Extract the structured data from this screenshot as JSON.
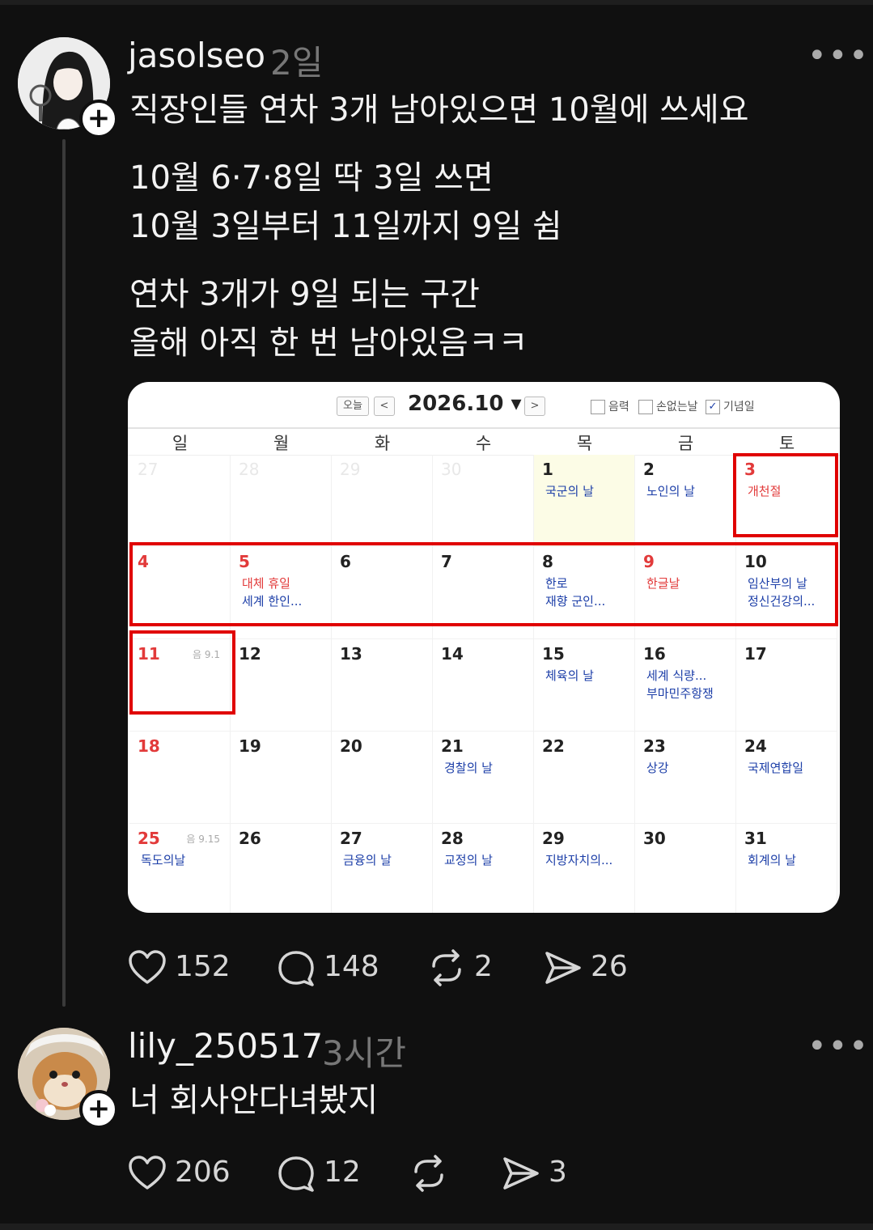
{
  "post": {
    "author": "jasolseo",
    "time": "2일",
    "more": "•••",
    "title_line": "직장인들 연차 3개 남아있으면 10월에 쓰세요",
    "body_lines": [
      "10월 6·7·8일 딱 3일 쓰면",
      "10월 3일부터 11일까지 9일 쉼",
      "연차 3개가 9일 되는 구간",
      "올해 아직 한 번 남아있음ㅋㅋ"
    ],
    "actions": {
      "likes": "152",
      "comments": "148",
      "reposts": "2",
      "shares": "26"
    }
  },
  "calendar": {
    "today_btn": "오늘",
    "prev": "<",
    "next": ">",
    "title": "2026.10 ▾",
    "options": [
      "음력",
      "손없는날",
      "기념일"
    ],
    "weekdays": [
      "일",
      "월",
      "화",
      "수",
      "목",
      "금",
      "토"
    ],
    "weeks": [
      [
        {
          "d": "27",
          "faded": true
        },
        {
          "d": "28",
          "faded": true
        },
        {
          "d": "29",
          "faded": true
        },
        {
          "d": "30",
          "faded": true
        },
        {
          "d": "1",
          "events": [
            "국군의 날"
          ],
          "today": true
        },
        {
          "d": "2",
          "events": [
            "노인의 날"
          ]
        },
        {
          "d": "3",
          "red": true,
          "events": [
            "개천절"
          ],
          "ev_red": true
        }
      ],
      [
        {
          "d": "4",
          "red": true
        },
        {
          "d": "5",
          "red": true,
          "events": [
            "대체 휴일",
            "세계 한인..."
          ],
          "ev_red_first": true
        },
        {
          "d": "6"
        },
        {
          "d": "7"
        },
        {
          "d": "8",
          "events": [
            "한로",
            "재향 군인..."
          ]
        },
        {
          "d": "9",
          "red": true,
          "events": [
            "한글날"
          ],
          "ev_red": true
        },
        {
          "d": "10",
          "events": [
            "임산부의 날",
            "정신건강의..."
          ]
        }
      ],
      [
        {
          "d": "11",
          "red": true,
          "lunar": "음 9.1"
        },
        {
          "d": "12"
        },
        {
          "d": "13"
        },
        {
          "d": "14"
        },
        {
          "d": "15",
          "events": [
            "체육의 날"
          ]
        },
        {
          "d": "16",
          "events": [
            "세계 식량...",
            "부마민주항쟁"
          ]
        },
        {
          "d": "17"
        }
      ],
      [
        {
          "d": "18",
          "red": true
        },
        {
          "d": "19"
        },
        {
          "d": "20"
        },
        {
          "d": "21",
          "events": [
            "경찰의 날"
          ]
        },
        {
          "d": "22"
        },
        {
          "d": "23",
          "events": [
            "상강"
          ]
        },
        {
          "d": "24",
          "events": [
            "국제연합일"
          ]
        }
      ],
      [
        {
          "d": "25",
          "red": true,
          "lunar": "음 9.15",
          "events": [
            "독도의날"
          ]
        },
        {
          "d": "26"
        },
        {
          "d": "27",
          "events": [
            "금융의 날"
          ]
        },
        {
          "d": "28",
          "events": [
            "교정의 날"
          ]
        },
        {
          "d": "29",
          "events": [
            "지방자치의..."
          ]
        },
        {
          "d": "30"
        },
        {
          "d": "31",
          "events": [
            "회계의 날"
          ]
        }
      ]
    ]
  },
  "reply": {
    "author": "lily_250517",
    "time": "3시간",
    "more": "•••",
    "text": "너 회사안다녀봤지",
    "actions": {
      "likes": "206",
      "comments": "12",
      "shares": "3"
    }
  }
}
